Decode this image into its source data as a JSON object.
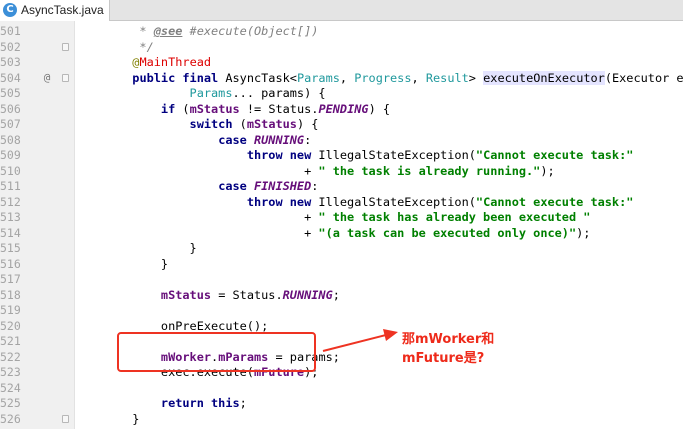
{
  "tab": {
    "icon": "C",
    "title": "AsyncTask.java"
  },
  "annotation": {
    "lines": [
      "那mWorker和",
      "mFuture是?"
    ],
    "color": "#ee2a1a"
  },
  "colors": {
    "keyword": "#000080",
    "string": "#008000",
    "field": "#660e7a",
    "comment": "#808080",
    "annotation": "#808000",
    "type_param": "#20999d",
    "highlight_box": "#ee3322"
  },
  "code_lines": [
    {
      "num": "501",
      "marker": "",
      "fold": false,
      "tokens": [
        {
          "t": "         * ",
          "c": "cmt"
        },
        {
          "t": "@see",
          "c": "tag"
        },
        {
          "t": " #execute(Object[])",
          "c": "cmt"
        }
      ]
    },
    {
      "num": "502",
      "marker": "",
      "fold": true,
      "tokens": [
        {
          "t": "         */",
          "c": "cmt"
        }
      ]
    },
    {
      "num": "503",
      "marker": "",
      "fold": false,
      "tokens": [
        {
          "t": "        ",
          "c": ""
        },
        {
          "t": "@",
          "c": "ann"
        },
        {
          "t": "MainThread",
          "c": "annred"
        }
      ]
    },
    {
      "num": "504",
      "marker": "@",
      "fold": true,
      "tokens": [
        {
          "t": "        ",
          "c": ""
        },
        {
          "t": "public final ",
          "c": "kw"
        },
        {
          "t": "AsyncTask<",
          "c": ""
        },
        {
          "t": "Params",
          "c": "tp"
        },
        {
          "t": ", ",
          "c": ""
        },
        {
          "t": "Progress",
          "c": "tp"
        },
        {
          "t": ", ",
          "c": ""
        },
        {
          "t": "Result",
          "c": "tp"
        },
        {
          "t": "> ",
          "c": ""
        },
        {
          "t": "executeOnExecutor",
          "c": "hl"
        },
        {
          "t": "(Executor exec,",
          "c": ""
        }
      ]
    },
    {
      "num": "505",
      "marker": "",
      "fold": false,
      "tokens": [
        {
          "t": "                ",
          "c": ""
        },
        {
          "t": "Params",
          "c": "tp"
        },
        {
          "t": "... params) {",
          "c": ""
        }
      ]
    },
    {
      "num": "506",
      "marker": "",
      "fold": false,
      "tokens": [
        {
          "t": "            ",
          "c": ""
        },
        {
          "t": "if ",
          "c": "kw"
        },
        {
          "t": "(",
          "c": ""
        },
        {
          "t": "mStatus",
          "c": "fld"
        },
        {
          "t": " != Status.",
          "c": ""
        },
        {
          "t": "PENDING",
          "c": "cst"
        },
        {
          "t": ") {",
          "c": ""
        }
      ]
    },
    {
      "num": "507",
      "marker": "",
      "fold": false,
      "tokens": [
        {
          "t": "                ",
          "c": ""
        },
        {
          "t": "switch ",
          "c": "kw"
        },
        {
          "t": "(",
          "c": ""
        },
        {
          "t": "mStatus",
          "c": "fld"
        },
        {
          "t": ") {",
          "c": ""
        }
      ]
    },
    {
      "num": "508",
      "marker": "",
      "fold": false,
      "tokens": [
        {
          "t": "                    ",
          "c": ""
        },
        {
          "t": "case ",
          "c": "kw"
        },
        {
          "t": "RUNNING",
          "c": "cst"
        },
        {
          "t": ":",
          "c": ""
        }
      ]
    },
    {
      "num": "509",
      "marker": "",
      "fold": false,
      "tokens": [
        {
          "t": "                        ",
          "c": ""
        },
        {
          "t": "throw new ",
          "c": "kw"
        },
        {
          "t": "IllegalStateException(",
          "c": ""
        },
        {
          "t": "\"Cannot execute task:\"",
          "c": "str"
        }
      ]
    },
    {
      "num": "510",
      "marker": "",
      "fold": false,
      "tokens": [
        {
          "t": "                                + ",
          "c": ""
        },
        {
          "t": "\" the task is already running.\"",
          "c": "str"
        },
        {
          "t": ");",
          "c": ""
        }
      ]
    },
    {
      "num": "511",
      "marker": "",
      "fold": false,
      "tokens": [
        {
          "t": "                    ",
          "c": ""
        },
        {
          "t": "case ",
          "c": "kw"
        },
        {
          "t": "FINISHED",
          "c": "cst"
        },
        {
          "t": ":",
          "c": ""
        }
      ]
    },
    {
      "num": "512",
      "marker": "",
      "fold": false,
      "tokens": [
        {
          "t": "                        ",
          "c": ""
        },
        {
          "t": "throw new ",
          "c": "kw"
        },
        {
          "t": "IllegalStateException(",
          "c": ""
        },
        {
          "t": "\"Cannot execute task:\"",
          "c": "str"
        }
      ]
    },
    {
      "num": "513",
      "marker": "",
      "fold": false,
      "tokens": [
        {
          "t": "                                + ",
          "c": ""
        },
        {
          "t": "\" the task has already been executed \"",
          "c": "str"
        }
      ]
    },
    {
      "num": "514",
      "marker": "",
      "fold": false,
      "tokens": [
        {
          "t": "                                + ",
          "c": ""
        },
        {
          "t": "\"(a task can be executed only once)\"",
          "c": "str"
        },
        {
          "t": ");",
          "c": ""
        }
      ]
    },
    {
      "num": "515",
      "marker": "",
      "fold": false,
      "tokens": [
        {
          "t": "                }",
          "c": ""
        }
      ]
    },
    {
      "num": "516",
      "marker": "",
      "fold": false,
      "tokens": [
        {
          "t": "            }",
          "c": ""
        }
      ]
    },
    {
      "num": "517",
      "marker": "",
      "fold": false,
      "tokens": []
    },
    {
      "num": "518",
      "marker": "",
      "fold": false,
      "tokens": [
        {
          "t": "            ",
          "c": ""
        },
        {
          "t": "mStatus",
          "c": "fld"
        },
        {
          "t": " = Status.",
          "c": ""
        },
        {
          "t": "RUNNING",
          "c": "cst"
        },
        {
          "t": ";",
          "c": ""
        }
      ]
    },
    {
      "num": "519",
      "marker": "",
      "fold": false,
      "tokens": []
    },
    {
      "num": "520",
      "marker": "",
      "fold": false,
      "tokens": [
        {
          "t": "            onPreExecute();",
          "c": ""
        }
      ]
    },
    {
      "num": "521",
      "marker": "",
      "fold": false,
      "tokens": []
    },
    {
      "num": "522",
      "marker": "",
      "fold": false,
      "tokens": [
        {
          "t": "            ",
          "c": ""
        },
        {
          "t": "mWorker",
          "c": "fld"
        },
        {
          "t": ".",
          "c": ""
        },
        {
          "t": "mParams",
          "c": "fld"
        },
        {
          "t": " = params;",
          "c": ""
        }
      ]
    },
    {
      "num": "523",
      "marker": "",
      "fold": false,
      "tokens": [
        {
          "t": "            exec.execute(",
          "c": ""
        },
        {
          "t": "mFuture",
          "c": "fld"
        },
        {
          "t": ");",
          "c": ""
        }
      ]
    },
    {
      "num": "524",
      "marker": "",
      "fold": false,
      "tokens": []
    },
    {
      "num": "525",
      "marker": "",
      "fold": false,
      "tokens": [
        {
          "t": "            ",
          "c": ""
        },
        {
          "t": "return this",
          "c": "kw"
        },
        {
          "t": ";",
          "c": ""
        }
      ]
    },
    {
      "num": "526",
      "marker": "",
      "fold": true,
      "tokens": [
        {
          "t": "        }",
          "c": ""
        }
      ]
    }
  ]
}
